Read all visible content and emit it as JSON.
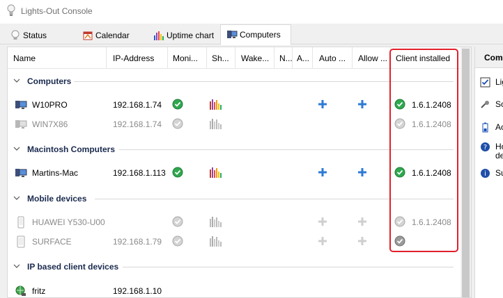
{
  "window": {
    "title": "Lights-Out Console"
  },
  "tabs": [
    {
      "label": "Status",
      "icon": "bulb-icon"
    },
    {
      "label": "Calendar",
      "icon": "calendar-icon"
    },
    {
      "label": "Uptime chart",
      "icon": "bar-chart-icon"
    },
    {
      "label": "Computers",
      "icon": "computer-icon",
      "active": true
    }
  ],
  "columns": {
    "name": "Name",
    "ip": "IP-Address",
    "monitor": "Moni...",
    "share": "Sh...",
    "wake": "Wake...",
    "n": "N...",
    "a": "A...",
    "auto": "Auto ...",
    "allow": "Allow ...",
    "client": "Client installed"
  },
  "groups": {
    "computers": "Computers",
    "mac": "Macintosh Computers",
    "mobile": "Mobile devices",
    "ip": "IP based client devices"
  },
  "rows": {
    "w10pro": {
      "name": "W10PRO",
      "ip": "192.168.1.74",
      "version": "1.6.1.2408"
    },
    "win7x86": {
      "name": "WIN7X86",
      "ip": "192.168.1.74",
      "version": "1.6.1.2408"
    },
    "mac": {
      "name": "Martins-Mac",
      "ip": "192.168.1.113",
      "version": "1.6.1.2408"
    },
    "huawei": {
      "name": "HUAWEI Y530-U00",
      "ip": "",
      "version": "1.6.1.2408"
    },
    "surface": {
      "name": "SURFACE",
      "ip": "192.168.1.79",
      "version": ""
    },
    "fritz": {
      "name": "fritz",
      "ip": "192.168.1.10",
      "version": ""
    }
  },
  "right_panel": {
    "title": "Comp",
    "items": [
      "Lig",
      "Sc",
      "Ac",
      "Ho de",
      "Su"
    ]
  },
  "colors": {
    "accent": "#1a2a4e",
    "highlight": "#e0202c",
    "ok": "#2fa84f"
  }
}
